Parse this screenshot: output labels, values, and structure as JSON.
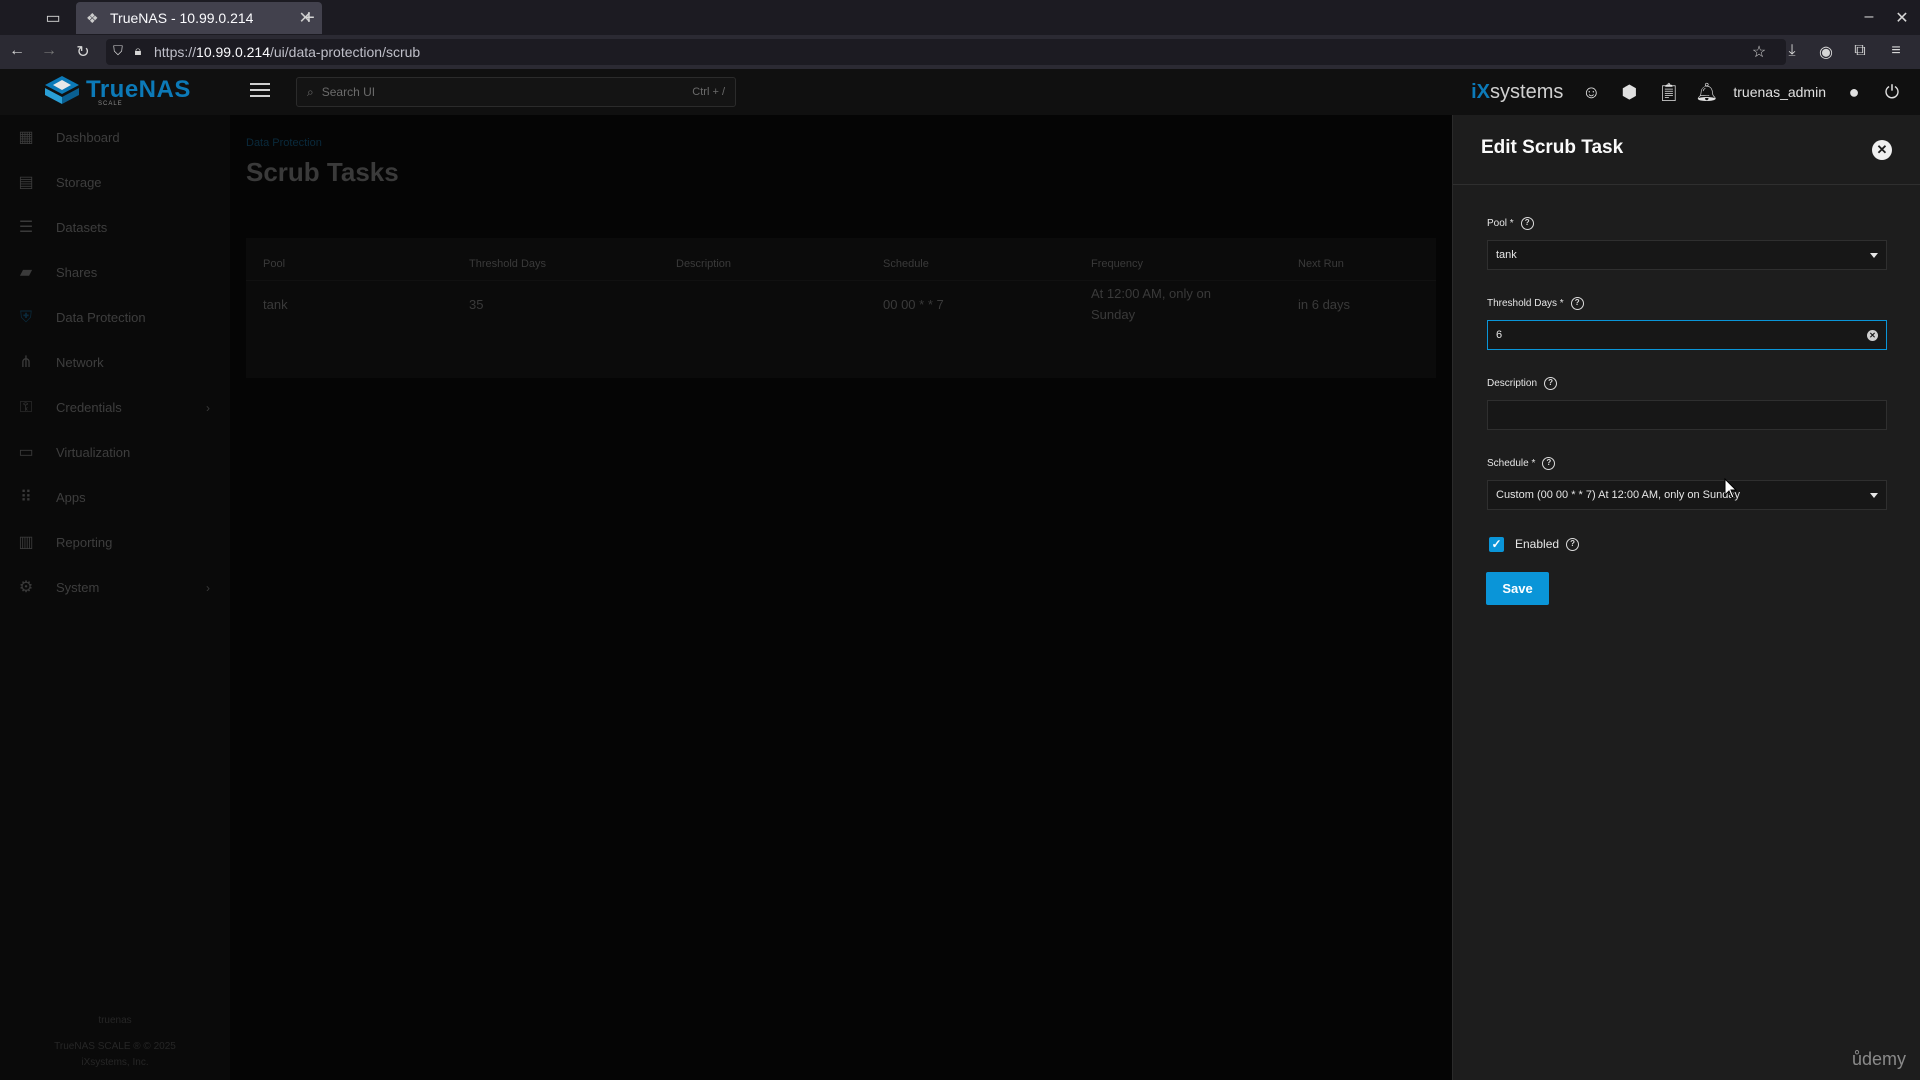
{
  "browser": {
    "tab_title": "TrueNAS - 10.99.0.214",
    "url_prefix": "https://",
    "url_host": "10.99.0.214",
    "url_path": "/ui/data-protection/scrub"
  },
  "header": {
    "logo_text": "TrueNAS",
    "logo_sub": "SCALE",
    "search_placeholder": "Search UI",
    "search_shortcut": "Ctrl + /",
    "brand": "systems",
    "brand_prefix": "iX",
    "username": "truenas_admin"
  },
  "sidebar": {
    "items": [
      {
        "label": "Dashboard",
        "icon": "dashboard-icon"
      },
      {
        "label": "Storage",
        "icon": "storage-icon"
      },
      {
        "label": "Datasets",
        "icon": "datasets-icon"
      },
      {
        "label": "Shares",
        "icon": "shares-icon"
      },
      {
        "label": "Data Protection",
        "icon": "shield-icon"
      },
      {
        "label": "Network",
        "icon": "network-icon"
      },
      {
        "label": "Credentials",
        "icon": "key-icon"
      },
      {
        "label": "Virtualization",
        "icon": "laptop-icon"
      },
      {
        "label": "Apps",
        "icon": "apps-grid-icon"
      },
      {
        "label": "Reporting",
        "icon": "bar-chart-icon"
      },
      {
        "label": "System",
        "icon": "gear-icon"
      }
    ],
    "footer_host": "truenas",
    "footer_version": "TrueNAS SCALE ® © 2025",
    "footer_company": "iXsystems, Inc."
  },
  "main": {
    "breadcrumb": "Data Protection",
    "title": "Scrub Tasks",
    "columns": [
      "Pool",
      "Threshold Days",
      "Description",
      "Schedule",
      "Frequency",
      "Next Run"
    ],
    "rows": [
      {
        "pool": "tank",
        "threshold": "35",
        "description": "",
        "schedule": "00 00 * * 7",
        "frequency_1": "At 12:00 AM, only on",
        "frequency_2": "Sunday",
        "next_run": "in 6 days"
      }
    ]
  },
  "panel": {
    "title": "Edit Scrub Task",
    "pool_label": "Pool *",
    "pool_value": "tank",
    "threshold_label": "Threshold Days *",
    "threshold_value": "6",
    "description_label": "Description",
    "description_value": "",
    "schedule_label": "Schedule *",
    "schedule_value": "Custom (00 00 * * 7) At 12:00 AM, only on Sunday",
    "enabled_label": "Enabled",
    "enabled": true,
    "save_label": "Save"
  },
  "watermark": "ůdemy",
  "colors": {
    "accent": "#0a95d8",
    "brand_blue": "#0c7ab8",
    "panel_bg": "#1d1d1d"
  }
}
